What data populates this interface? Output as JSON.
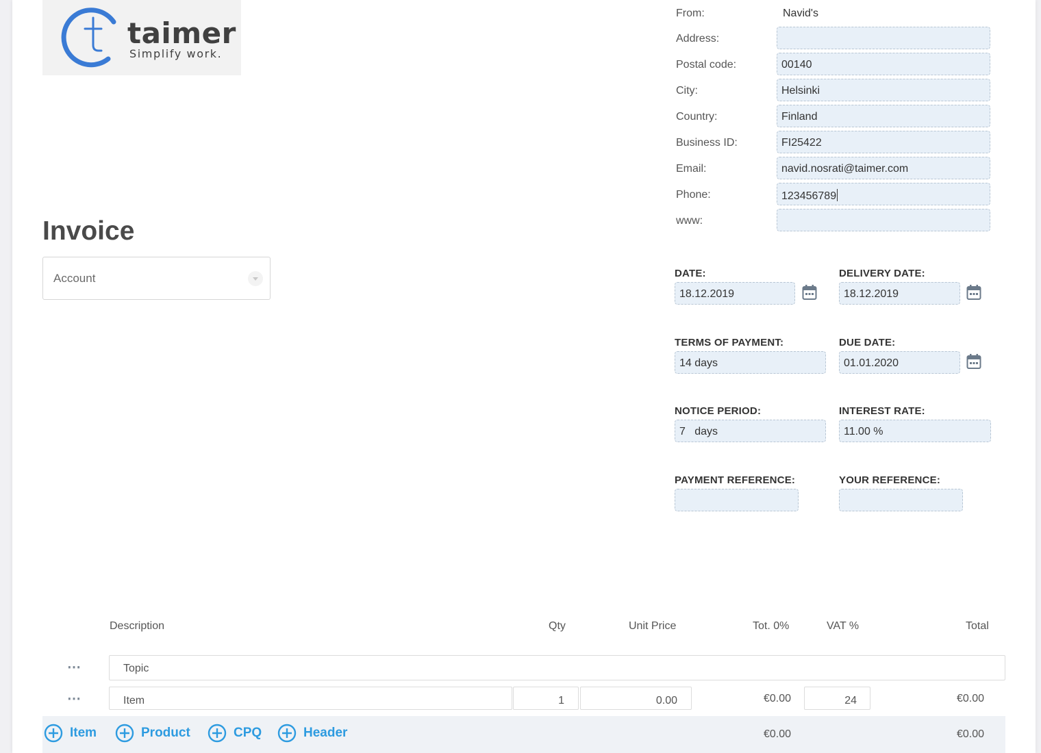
{
  "logo": {
    "word": "taimer",
    "tagline": "Simplify work."
  },
  "title": "Invoice",
  "account": {
    "placeholder": "Account"
  },
  "sender": {
    "from_label": "From:",
    "from_value": "Navid's",
    "rows": [
      {
        "label": "Address:",
        "value": ""
      },
      {
        "label": "Postal code:",
        "value": "00140"
      },
      {
        "label": "City:",
        "value": "Helsinki"
      },
      {
        "label": "Country:",
        "value": "Finland"
      },
      {
        "label": "Business ID:",
        "value": "FI25422"
      },
      {
        "label": "Email:",
        "value": "navid.nosrati@taimer.com"
      },
      {
        "label": "Phone:",
        "value": "123456789"
      },
      {
        "label": "www:",
        "value": ""
      }
    ]
  },
  "details": {
    "date": {
      "label": "DATE:",
      "value": "18.12.2019"
    },
    "delivery_date": {
      "label": "DELIVERY DATE:",
      "value": "18.12.2019"
    },
    "terms": {
      "label": "TERMS OF PAYMENT:",
      "value": "14 days"
    },
    "due_date": {
      "label": "DUE DATE:",
      "value": "01.01.2020"
    },
    "notice_period": {
      "label": "NOTICE PERIOD:",
      "value": "7   days"
    },
    "interest_rate": {
      "label": "INTEREST RATE:",
      "value": "11.00 %"
    },
    "payment_reference": {
      "label": "PAYMENT REFERENCE:",
      "value": ""
    },
    "your_reference": {
      "label": "YOUR REFERENCE:",
      "value": ""
    }
  },
  "table": {
    "headers": {
      "description": "Description",
      "qty": "Qty",
      "unit_price": "Unit Price",
      "tot": "Tot. 0%",
      "vat": "VAT %",
      "total": "Total"
    },
    "menu_icon": "⋯",
    "topic_row": {
      "description": "Topic"
    },
    "item_row": {
      "description": "Item",
      "qty": "1",
      "unit_price": "0.00",
      "tot": "€0.00",
      "vat": "24",
      "total": "€0.00"
    },
    "footer": {
      "tot": "€0.00",
      "total": "€0.00"
    },
    "add_buttons": {
      "item": "Item",
      "product": "Product",
      "cpq": "CPQ",
      "header": "Header"
    }
  },
  "colors": {
    "accent": "#2d9be0",
    "field_bg": "#e8f0f8",
    "logo_blue": "#3a7bd5"
  }
}
